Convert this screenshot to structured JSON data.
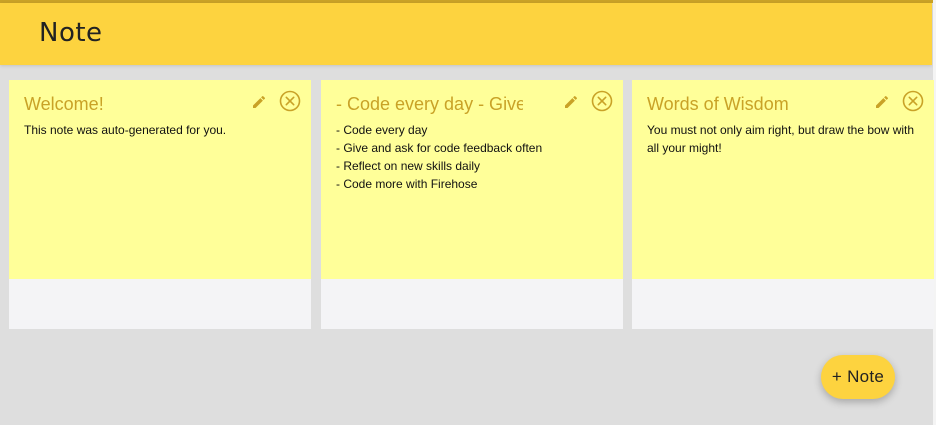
{
  "app": {
    "title": "Note"
  },
  "notes": [
    {
      "title": "Welcome!",
      "body_lines": [
        "This note was auto-generated for you."
      ]
    },
    {
      "title": "- Code every day - Give and ask for code feedback often",
      "body_lines": [
        "- Code every day",
        "- Give and ask for code feedback often",
        "- Reflect on new skills daily",
        "- Code more with Firehose"
      ]
    },
    {
      "title": "Words of Wisdom",
      "body_lines": [
        "You must not only aim right, but draw the bow with all your might!"
      ]
    }
  ],
  "icons": {
    "edit": "pencil-icon",
    "close": "close-circle-icon"
  },
  "add_button": {
    "label": "+ Note"
  },
  "colors": {
    "header": "#fdd33f",
    "note_paper": "#ffff99",
    "note_title": "#c9a227",
    "background": "#dedede"
  }
}
